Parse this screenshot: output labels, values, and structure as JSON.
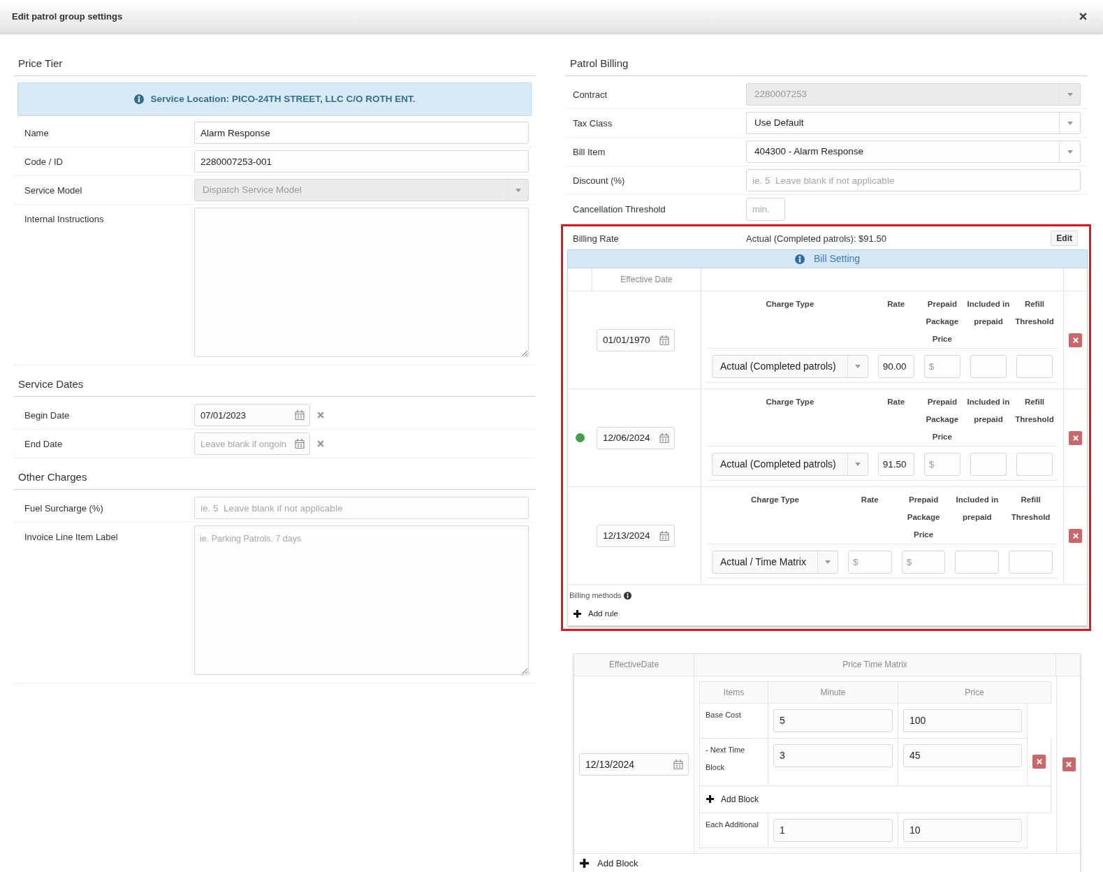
{
  "dialog": {
    "title": "Edit patrol group settings"
  },
  "price_tier": {
    "heading": "Price Tier",
    "banner": "Service Location: PICO-24TH STREET, LLC C/O ROTH ENT.",
    "fields": [
      {
        "kind": "text",
        "label": "Name",
        "value": "Alarm Response",
        "disabled": false
      },
      {
        "kind": "text",
        "label": "Code / ID",
        "value": "2280007253-001",
        "disabled": false
      },
      {
        "kind": "select",
        "label": "Service Model",
        "value": "Dispatch Service Model",
        "disabled": true
      },
      {
        "kind": "textarea",
        "label": "Internal Instructions",
        "disabled": false
      }
    ]
  },
  "service_dates": {
    "heading": "Service Dates",
    "fields": [
      {
        "kind": "date",
        "label": "Begin Date",
        "value": "07/01/2023"
      },
      {
        "kind": "date",
        "label": "End Date",
        "placeholder": "Leave blank if ongoin"
      }
    ]
  },
  "other_charges": {
    "heading": "Other Charges",
    "fields": [
      {
        "kind": "text",
        "label": "Fuel Surcharge (%)",
        "placeholder": "ie. 5  Leave blank if not applicable"
      },
      {
        "kind": "textarea",
        "label": "Invoice Line Item Label",
        "placeholder": "ie. Parking Patrols. 7 days"
      }
    ]
  },
  "patrol_billing": {
    "heading": "Patrol Billing",
    "fields": [
      {
        "kind": "select",
        "label": "Contract",
        "value": "2280007253",
        "disabled": true
      },
      {
        "kind": "select",
        "label": "Tax Class",
        "value": "Use Default",
        "disabled": false
      },
      {
        "kind": "select",
        "label": "Bill Item",
        "value": "404300 - Alarm Response",
        "disabled": false
      },
      {
        "kind": "text",
        "label": "Discount (%)",
        "placeholder": "ie. 5  Leave blank if not applicable",
        "disabled": false
      },
      {
        "kind": "short",
        "label": "Cancellation Threshold",
        "placeholder": "min.",
        "disabled": false
      }
    ]
  },
  "billing_rate": {
    "label": "Billing Rate",
    "summary": "Actual (Completed patrols): $91.50",
    "edit_button": "Edit",
    "highlighted": true,
    "banner": "Bill Setting",
    "date_column": "Effective Date",
    "rules": [
      {
        "date": "01/01/1970",
        "current": false,
        "headers": [
          "Charge Type",
          "Rate",
          "Prepaid Package Price",
          "Included in prepaid",
          "Refill Threshold"
        ],
        "cells": [
          {
            "kind": "select",
            "value": "Actual (Completed patrols)"
          },
          {
            "kind": "input",
            "value": "90.00"
          },
          {
            "kind": "input",
            "placeholder": "$"
          },
          {
            "kind": "input"
          },
          {
            "kind": "input"
          }
        ]
      },
      {
        "date": "12/06/2024",
        "current": true,
        "headers": [
          "Charge Type",
          "Rate",
          "Prepaid Package Price",
          "Included in prepaid",
          "Refill Threshold"
        ],
        "cells": [
          {
            "kind": "select",
            "value": "Actual (Completed patrols)"
          },
          {
            "kind": "input",
            "value": "91.50"
          },
          {
            "kind": "input",
            "placeholder": "$"
          },
          {
            "kind": "input"
          },
          {
            "kind": "input"
          }
        ]
      },
      {
        "date": "12/13/2024",
        "current": false,
        "headers": [
          "Charge Type",
          "Rate",
          "Prepaid Package Price",
          "Included in prepaid",
          "Refill Threshold"
        ],
        "cells": [
          {
            "kind": "select",
            "value": "Actual / Time Matrix"
          },
          {
            "kind": "input",
            "placeholder": "$"
          },
          {
            "kind": "input",
            "placeholder": "$"
          },
          {
            "kind": "input"
          },
          {
            "kind": "input"
          }
        ]
      }
    ],
    "footer_label": "Billing methods",
    "add_button": "Add rule"
  },
  "time_matrix": {
    "columns": [
      "EffectiveDate",
      "Price Time Matrix"
    ],
    "entries": [
      {
        "date": "12/13/2024",
        "item_columns": [
          "Items",
          "Minute",
          "Price"
        ],
        "rows": [
          {
            "kind": "block",
            "label": "Base Cost",
            "minute": "5",
            "price": "100",
            "removable": false
          },
          {
            "kind": "block",
            "label": "- Next Time Block",
            "minute": "3",
            "price": "45",
            "removable": true
          },
          {
            "kind": "add",
            "label": "Add Block"
          },
          {
            "kind": "block",
            "label": "Each Additional",
            "minute": "1",
            "price": "10",
            "removable": false
          }
        ]
      }
    ],
    "add_button": "Add Block"
  }
}
